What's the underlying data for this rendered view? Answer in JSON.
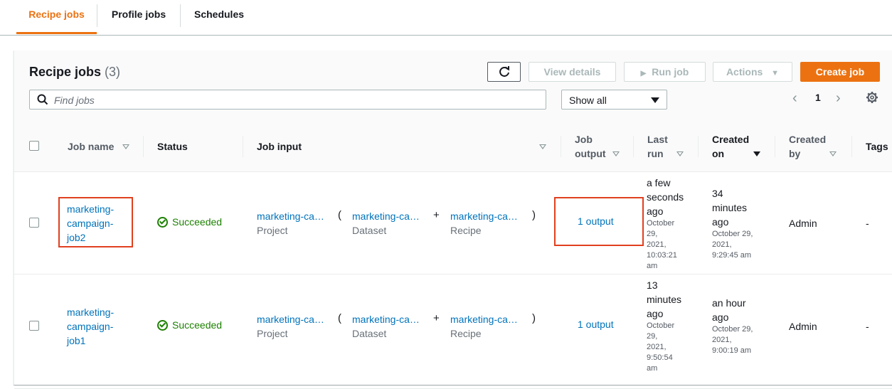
{
  "tabs": [
    "Recipe jobs",
    "Profile jobs",
    "Schedules"
  ],
  "panel": {
    "title": "Recipe jobs",
    "count": "(3)",
    "buttons": {
      "view_details": "View details",
      "run_job": "Run job",
      "actions": "Actions",
      "create_job": "Create job"
    },
    "search_placeholder": "Find jobs",
    "filter_value": "Show all",
    "page": "1"
  },
  "columns": {
    "job_name": "Job name",
    "status": "Status",
    "job_input": "Job input",
    "job_output_1": "Job",
    "job_output_2": "output",
    "last_run_1": "Last",
    "last_run_2": "run",
    "created_on_1": "Created",
    "created_on_2": "on",
    "created_by_1": "Created",
    "created_by_2": "by",
    "tags": "Tags"
  },
  "rows": [
    {
      "name": [
        "marketing-",
        "campaign-",
        "job2"
      ],
      "status": "Succeeded",
      "project": "marketing-ca…",
      "project_label": "Project",
      "dataset": "marketing-ca…",
      "dataset_label": "Dataset",
      "recipe": "marketing-ca…",
      "recipe_label": "Recipe",
      "output": "1 output",
      "last_run": [
        "a few",
        "seconds",
        "ago"
      ],
      "last_run_date": [
        "October",
        "29,",
        "2021,",
        "10:03:21",
        "am"
      ],
      "created": [
        "34",
        "minutes",
        "ago"
      ],
      "created_date": [
        "October 29,",
        "2021,",
        "9:29:45 am"
      ],
      "created_by": "Admin",
      "tags": "-"
    },
    {
      "name": [
        "marketing-",
        "campaign-",
        "job1"
      ],
      "status": "Succeeded",
      "project": "marketing-ca…",
      "project_label": "Project",
      "dataset": "marketing-ca…",
      "dataset_label": "Dataset",
      "recipe": "marketing-ca…",
      "recipe_label": "Recipe",
      "output": "1 output",
      "last_run": [
        "13",
        "minutes",
        "ago"
      ],
      "last_run_date": [
        "October",
        "29,",
        "2021,",
        "9:50:54",
        "am"
      ],
      "created": [
        "an hour",
        "ago"
      ],
      "created_date": [
        "October 29,",
        "2021,",
        "9:00:19 am"
      ],
      "created_by": "Admin",
      "tags": "-"
    }
  ],
  "symbols": {
    "open_paren": "(",
    "plus": "+",
    "close_paren": ")"
  }
}
